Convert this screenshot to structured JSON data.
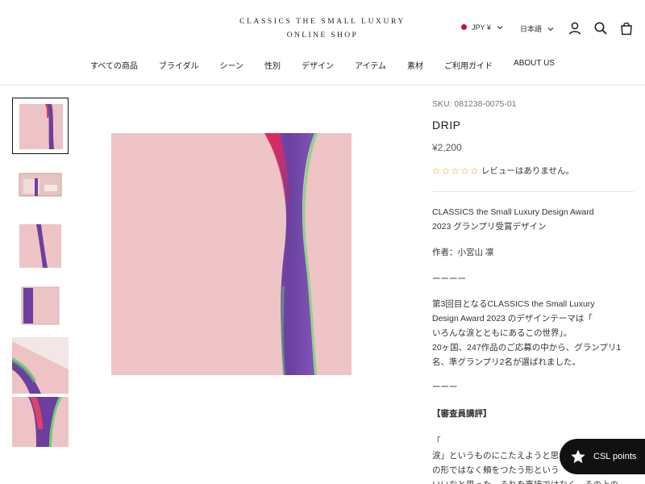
{
  "header": {
    "logo_line1": "CLASSICS THE SMALL LUXURY",
    "logo_line2": "ONLINE SHOP",
    "currency": "JPY ¥",
    "language": "日本語",
    "icons": [
      "account-icon",
      "search-icon",
      "cart-icon"
    ]
  },
  "nav": {
    "items": [
      "すべての商品",
      "ブライダル",
      "シーン",
      "性別",
      "デザイン",
      "アイテム",
      "素材",
      "ご利用ガイド",
      "ABOUT US"
    ]
  },
  "product": {
    "sku": "SKU: 081238-0075-01",
    "title": "DRIP",
    "price": "¥2,200",
    "rating": 0,
    "review_text": "レビューはありません。",
    "desc1_line1": "CLASSICS the Small Luxury Design Award",
    "desc1_line2": "2023 グランプリ受賞デザイン",
    "author": "作者：小宮山 凛",
    "dashes1": "ーーーー",
    "para_line1": "第3回目となるCLASSICS the Small Luxury",
    "para_line2": "Design Award 2023 のデザインテーマは「",
    "para_line3": "いろんな涙とともにあるこの世界」。",
    "para_line4": "20ヶ国、247作品のご応募の中から、グランプリ1",
    "para_line5": "名、準グランプリ2名が選ばれました。",
    "dashes2": "ーーー",
    "review_heading": "【審査員講評】",
    "quote_open": "「",
    "quote_line1": "涙」というものにこたえようと思",
    "quote_line2": "の形ではなく頬をつたう形という",
    "quote_line3": "いいなと思った。それを直接ではなく、その上の"
  },
  "colors": {
    "pink": "#eec3c5",
    "purple": "#6c3f9f",
    "accent_red": "#c8102e",
    "star": "#e0a820"
  },
  "floating": {
    "csl_label": "CSL points"
  }
}
